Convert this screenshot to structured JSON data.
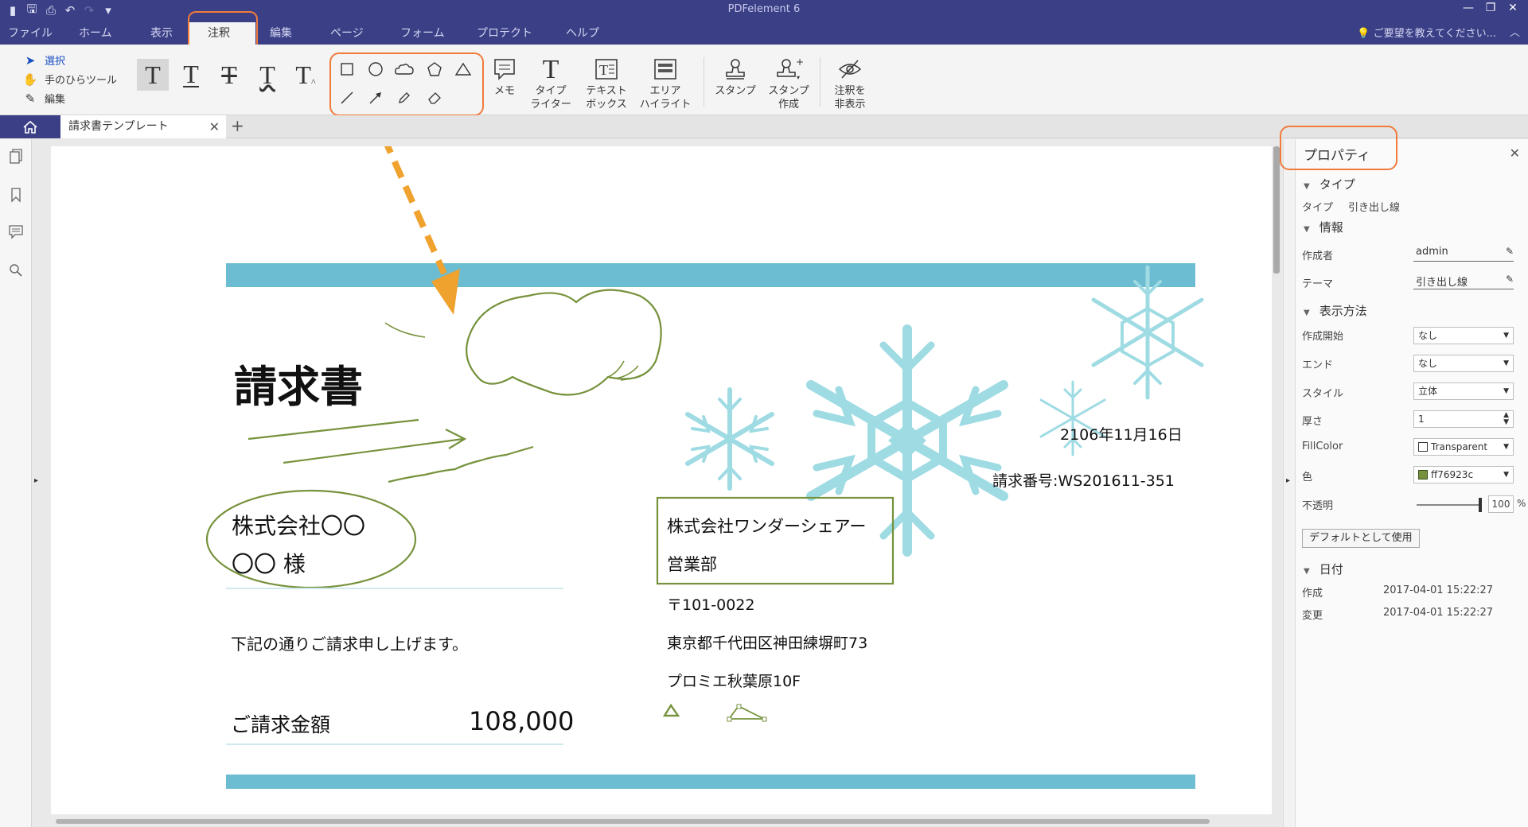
{
  "app": {
    "title": "PDFelement 6",
    "accent_color": "#3b3f86",
    "highlight_color": "#f07b3b"
  },
  "menu": {
    "tabs": [
      {
        "label": "ファイル"
      },
      {
        "label": "ホーム"
      },
      {
        "label": "表示"
      },
      {
        "label": "注釈"
      },
      {
        "label": "編集"
      },
      {
        "label": "ページ"
      },
      {
        "label": "フォーム"
      },
      {
        "label": "プロテクト"
      },
      {
        "label": "ヘルプ"
      }
    ],
    "active_tab": "注釈",
    "help_search": "ご要望を教えてください..."
  },
  "ribbon": {
    "modes": [
      {
        "label": "選択",
        "icon": "cursor-icon"
      },
      {
        "label": "手のひらツール",
        "icon": "hand-icon"
      },
      {
        "label": "編集",
        "icon": "edit-icon"
      }
    ],
    "text_glyph": "T",
    "text_tools": [
      "highlight-text",
      "underline-text",
      "strikethrough-text",
      "squiggly-text",
      "insert-text"
    ],
    "shape_tools": [
      "rectangle",
      "ellipse",
      "cloud",
      "polygon",
      "triangle",
      "line",
      "arrow",
      "pencil",
      "eraser"
    ],
    "big_buttons": [
      {
        "label": "メモ",
        "icon": "note-icon"
      },
      {
        "label1": "タイプ",
        "label2": "ライター",
        "icon": "typewriter-icon"
      },
      {
        "label1": "テキスト",
        "label2": "ボックス",
        "icon": "textbox-icon"
      },
      {
        "label1": "エリア",
        "label2": "ハイライト",
        "icon": "area-highlight-icon"
      },
      {
        "label": "スタンプ",
        "icon": "stamp-icon"
      },
      {
        "label1": "スタンプ",
        "label2": "作成",
        "icon": "create-stamp-icon"
      },
      {
        "label1": "注釈を",
        "label2": "非表示",
        "icon": "hide-annotations-icon"
      }
    ]
  },
  "tabs": {
    "document": "請求書テンプレート"
  },
  "document": {
    "title": "請求書",
    "recipient_company": "株式会社〇〇",
    "recipient_person": "〇〇 様",
    "intro": "下記の通りご請求申し上げます。",
    "amount_label": "ご請求金額",
    "amount": "108,000",
    "date": "2106年11月16日",
    "invoice_number": "請求番号:WS201611-351",
    "sender_company": "株式会社ワンダーシェアー",
    "sender_dept": "営業部",
    "postal": "〒101-0022",
    "address1": "東京都千代田区神田練塀町73",
    "address2": "プロミエ秋葉原10F",
    "band_color": "#6cbcd2",
    "annotation_color": "#76923c",
    "snow_color": "#9fdbe3"
  },
  "properties": {
    "title": "プロパティ",
    "sections": {
      "type": "タイプ",
      "info": "情報",
      "display": "表示方法",
      "date": "日付"
    },
    "type_label": "タイプ",
    "type_value": "引き出し線",
    "author_label": "作成者",
    "author_value": "admin",
    "subject_label": "テーマ",
    "subject_value": "引き出し線",
    "start_label": "作成開始",
    "start_value": "なし",
    "end_label": "エンド",
    "end_value": "なし",
    "style_label": "スタイル",
    "style_value": "立体",
    "thickness_label": "厚さ",
    "thickness_value": "1",
    "fill_label": "FillColor",
    "fill_value": "Transparent",
    "color_label": "色",
    "color_value": "ff76923c",
    "color_hex": "#76923c",
    "opacity_label": "不透明",
    "opacity_value": "100",
    "opacity_unit": "%",
    "opacity_level": 1.0,
    "default_button": "デフォルトとして使用",
    "created_label": "作成",
    "created_value": "2017-04-01 15:22:27",
    "modified_label": "変更",
    "modified_value": "2017-04-01 15:22:27"
  }
}
